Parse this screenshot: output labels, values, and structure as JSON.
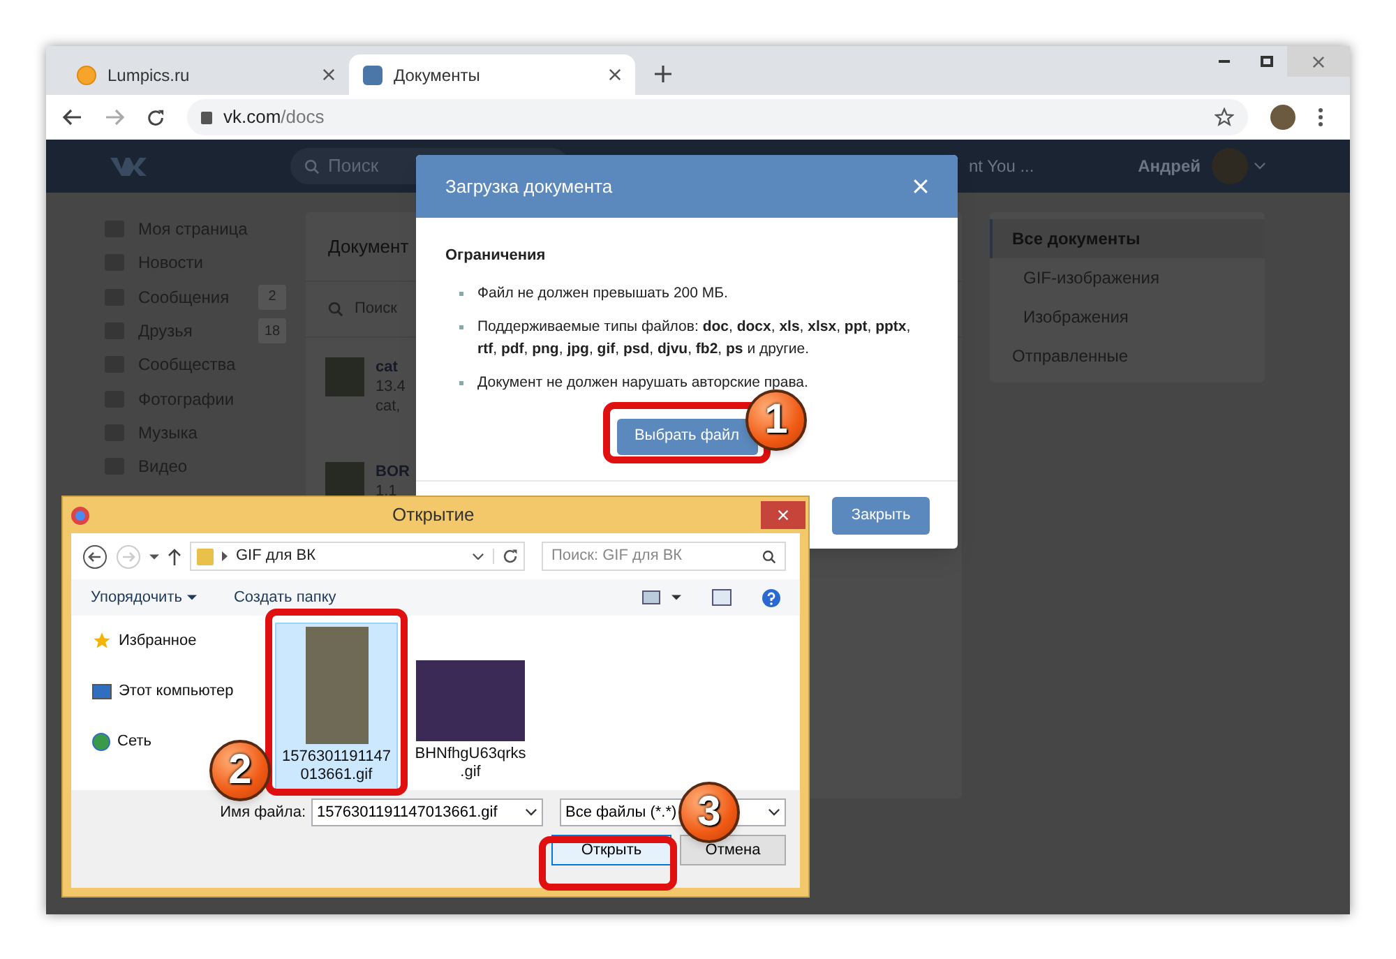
{
  "browser": {
    "tabs": [
      {
        "title": "Lumpics.ru",
        "selected": false
      },
      {
        "title": "Документы",
        "selected": true
      }
    ],
    "url_host": "vk.com",
    "url_path": "/docs"
  },
  "vk_header": {
    "search_placeholder": "Поиск",
    "now_playing": "nt You ...",
    "user_name": "Андрей"
  },
  "left_menu": [
    {
      "label": "Моя страница"
    },
    {
      "label": "Новости"
    },
    {
      "label": "Сообщения",
      "count": "2"
    },
    {
      "label": "Друзья",
      "count": "18"
    },
    {
      "label": "Сообщества"
    },
    {
      "label": "Фотографии"
    },
    {
      "label": "Музыка"
    },
    {
      "label": "Видео"
    }
  ],
  "documents_panel": {
    "title": "Документ",
    "search_placeholder": "Поиск",
    "items": [
      {
        "name": "cat",
        "size": "13.4",
        "tags": "cat,"
      },
      {
        "name": "BOR",
        "size": "1.1"
      }
    ]
  },
  "filter_menu": [
    {
      "label": "Все документы",
      "selected": true,
      "kind": "main"
    },
    {
      "label": "GIF-изображения",
      "selected": false,
      "kind": "sub"
    },
    {
      "label": "Изображения",
      "selected": false,
      "kind": "sub"
    },
    {
      "label": "Отправленные",
      "selected": false,
      "kind": "main"
    }
  ],
  "upload_modal": {
    "title": "Загрузка документа",
    "section": "Ограничения",
    "rules": [
      "Файл не должен превышать 200 МБ.",
      "Поддерживаемые типы файлов: **doc**, **docx**, **xls**, **xlsx**, **ppt**, **pptx**, **rtf**, **pdf**, **png**, **jpg**, **gif**, **psd**, **djvu**, **fb2**, **ps** и другие.",
      "Документ не должен нарушать авторские права."
    ],
    "choose_button": "Выбрать файл",
    "close_button": "Закрыть"
  },
  "file_dialog": {
    "title": "Открытие",
    "path": "GIF для ВК",
    "search_placeholder": "Поиск: GIF для ВК",
    "organize": "Упорядочить",
    "new_folder": "Создать папку",
    "nav": [
      {
        "label": "Избранное",
        "kind": "favorites"
      },
      {
        "label": "Этот компьютер",
        "kind": "computer"
      },
      {
        "label": "Сеть",
        "kind": "network"
      }
    ],
    "files": [
      {
        "name": "1576301191147013661.gif",
        "selected": true,
        "kind": "photo"
      },
      {
        "name": "BHNfhgU63qrks.gif",
        "selected": false,
        "kind": "illustration"
      }
    ],
    "filename_label": "Имя файла:",
    "filename_value": "1576301191147013661.gif",
    "filter": "Все файлы (*.*)",
    "open_button": "Открыть",
    "cancel_button": "Отмена"
  },
  "annotations": [
    {
      "number": "1"
    },
    {
      "number": "2"
    },
    {
      "number": "3"
    }
  ]
}
